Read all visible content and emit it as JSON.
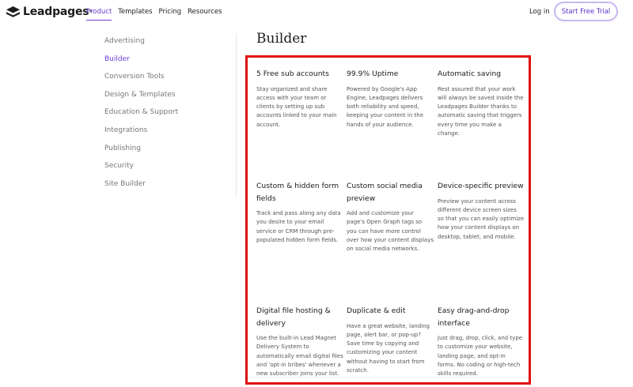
{
  "header": {
    "logo_text": "Leadpages",
    "logo_mark": "®",
    "nav": [
      "Product",
      "Templates",
      "Pricing",
      "Resources"
    ],
    "nav_active_index": 0,
    "login_label": "Log in",
    "cta_label": "Start Free Trial"
  },
  "sidebar": {
    "items": [
      "Advertising",
      "Builder",
      "Conversion Tools",
      "Design & Templates",
      "Education & Support",
      "Integrations",
      "Publishing",
      "Security",
      "Site Builder"
    ],
    "active_index": 1
  },
  "main": {
    "title": "Builder",
    "features": [
      {
        "title": "5 Free sub accounts",
        "desc": "Stay organized and share access with your team or clients by setting up sub accounts linked to your main account."
      },
      {
        "title": "99.9% Uptime",
        "desc": "Powered by Google's App Engine, Leadpages delivers both reliability and speed, keeping your content in the hands of your audience."
      },
      {
        "title": "Automatic saving",
        "desc": "Rest assured that your work will always be saved inside the Leadpages Builder thanks to automatic saving that triggers every time you make a change."
      },
      {
        "title": "Custom & hidden form fields",
        "desc": "Track and pass along any data you desire to your email service or CRM through pre-populated hidden form fields."
      },
      {
        "title": "Custom social media preview",
        "desc": "Add and customize your page's Open Graph tags so you can have more control over how your content displays on social media networks."
      },
      {
        "title": "Device-specific preview",
        "desc": "Preview your content across different device screen sizes so that you can easily optimize how your content displays on desktop, tablet, and mobile."
      },
      {
        "title": "Digital file hosting & delivery",
        "desc": "Use the built-in Lead Magnet Delivery System to automatically email digital files and 'opt-in bribes' whenever a new subscriber joins your list."
      },
      {
        "title": "Duplicate & edit",
        "desc": "Have a great website, landing page, alert bar, or pop-up? Save time by copying and customizing your content without having to start from scratch."
      },
      {
        "title": "Easy drag-and-drop interface",
        "desc": "Just drag, drop, click, and type to customize your website, landing page, and opt-in forms. No coding or high-tech skills required."
      }
    ]
  },
  "colors": {
    "accent": "#6b3fd4",
    "highlight_border": "#e01010"
  }
}
